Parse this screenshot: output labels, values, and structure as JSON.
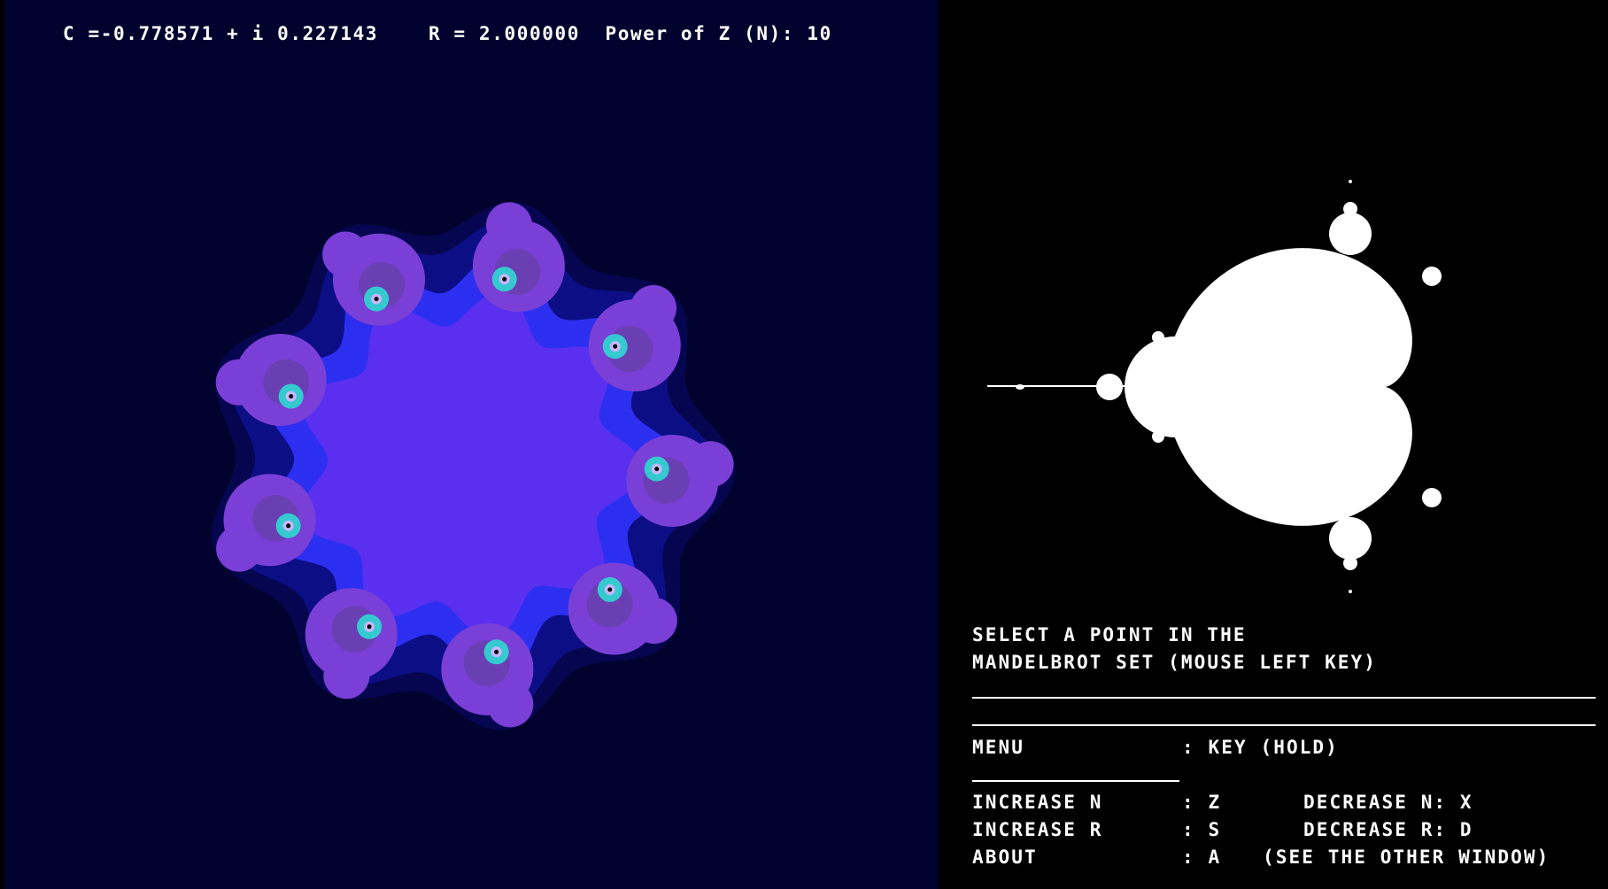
{
  "status": {
    "c_label": "C =-0.778571 + i 0.227143",
    "r_label": "R = 2.000000",
    "n_label": "Power of Z (N): 10"
  },
  "colors": {
    "julia_background": "#02022e",
    "julia_ring1": "#05064f",
    "julia_ring2": "#0c0e86",
    "julia_ring3": "#2d2ff0",
    "julia_interior": "#5a2ff0",
    "julia_bulb": "#7a3fd6",
    "julia_detail": "#35c9d0",
    "mandelbrot_fill": "#ffffff",
    "mandelbrot_background": "#000000"
  },
  "instructions": {
    "line1": "SELECT A POINT IN THE",
    "line2": "MANDELBROT SET (MOUSE LEFT KEY)"
  },
  "menu": {
    "header_left": "MENU",
    "header_right": ": KEY (HOLD)",
    "rows": [
      {
        "label": "INCREASE N",
        "key": ": Z",
        "extra": "DECREASE N: X"
      },
      {
        "label": "INCREASE R",
        "key": ": S",
        "extra": "DECREASE R: D"
      },
      {
        "label": "ABOUT",
        "key": ": A",
        "extra": "(SEE THE OTHER WINDOW)"
      }
    ]
  }
}
